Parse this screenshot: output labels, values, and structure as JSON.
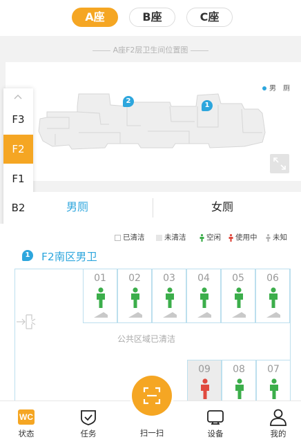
{
  "buildings": [
    {
      "label": "A座",
      "active": true
    },
    {
      "label": "B座",
      "active": false
    },
    {
      "label": "C座",
      "active": false
    }
  ],
  "map": {
    "title": "A座F2层卫生间位置图",
    "legend_label": "男",
    "legend_label2": "厕",
    "pins": [
      "2",
      "1"
    ]
  },
  "floors": [
    {
      "label": "F3",
      "active": false
    },
    {
      "label": "F2",
      "active": true
    },
    {
      "label": "F1",
      "active": false
    },
    {
      "label": "B2",
      "active": false
    }
  ],
  "tabs": [
    {
      "label": "男厕",
      "active": true
    },
    {
      "label": "女厕",
      "active": false
    }
  ],
  "legend": {
    "cleaned": "已清洁",
    "not_cleaned": "未清洁",
    "free": "空闲",
    "in_use": "使用中",
    "unknown": "未知"
  },
  "area": {
    "pin": "1",
    "title": "F2南区男卫",
    "public_status": "公共区域已清洁"
  },
  "stalls_top": [
    {
      "num": "01",
      "status": "free",
      "cleaned": true
    },
    {
      "num": "02",
      "status": "free",
      "cleaned": true
    },
    {
      "num": "03",
      "status": "free",
      "cleaned": true
    },
    {
      "num": "04",
      "status": "free",
      "cleaned": true
    },
    {
      "num": "05",
      "status": "free",
      "cleaned": true
    },
    {
      "num": "06",
      "status": "free",
      "cleaned": true
    }
  ],
  "stalls_bottom": [
    {
      "num": "09",
      "status": "in_use",
      "cleaned": false
    },
    {
      "num": "08",
      "status": "free",
      "cleaned": true
    },
    {
      "num": "07",
      "status": "free",
      "cleaned": true
    }
  ],
  "nav": {
    "status": "状态",
    "status_badge": "WC",
    "tasks": "任务",
    "scan": "扫一扫",
    "devices": "设备",
    "me": "我的"
  },
  "colors": {
    "accent": "#f5a623",
    "blue": "#2da6dd",
    "free": "#3cae4b",
    "in_use": "#e04a3f",
    "unknown": "#b5b5b5"
  }
}
